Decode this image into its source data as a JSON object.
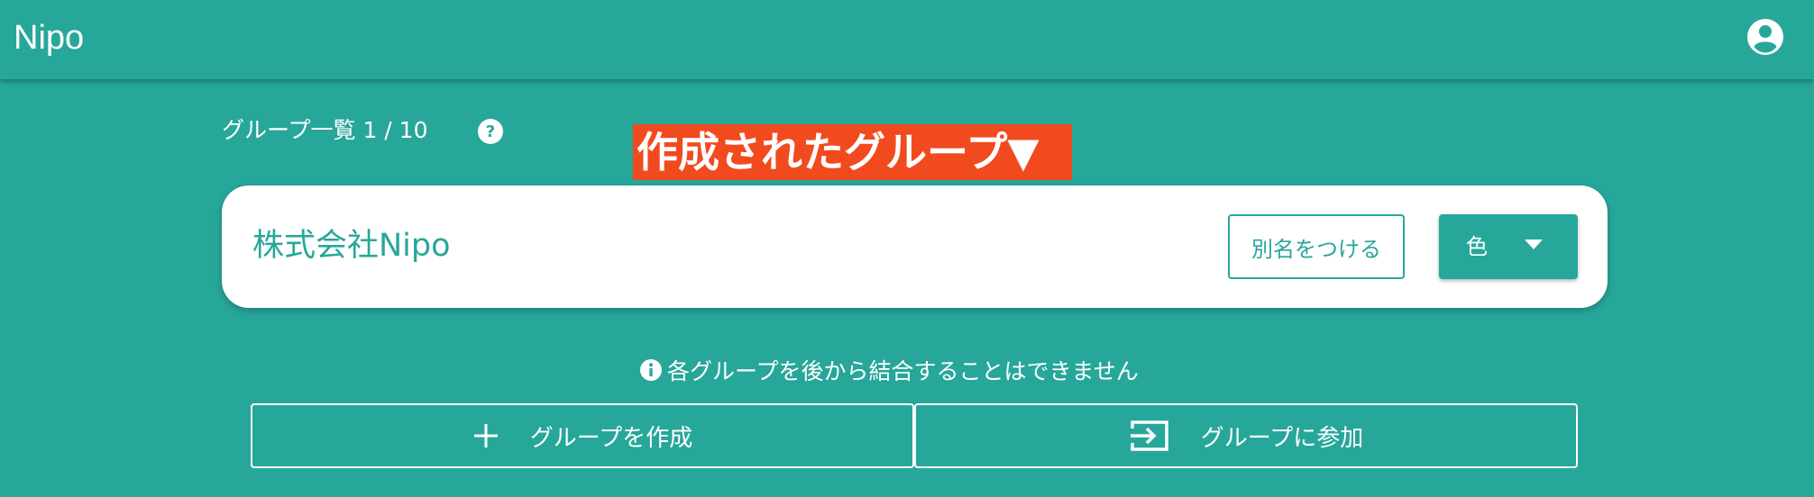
{
  "appbar": {
    "title": "Nipo",
    "account_icon": "account-circle-icon"
  },
  "groups": {
    "count_label": "グループ一覧 1 / 10",
    "help_icon": "help-circle-icon"
  },
  "annotation": {
    "text": "作成されたグループ▼"
  },
  "card": {
    "name": "株式会社Nipo",
    "alias_label": "別名をつける",
    "color_label": "色",
    "color_caret_icon": "caret-down-icon"
  },
  "notice": {
    "text": "各グループを後から結合することはできません",
    "icon": "info-circle-icon"
  },
  "actions": {
    "create_label": "グループを作成",
    "create_icon": "plus-icon",
    "join_label": "グループに参加",
    "join_icon": "login-icon"
  },
  "colors": {
    "primary": "#27a79a",
    "annotation": "#f24a1f",
    "card": "#ffffff"
  }
}
